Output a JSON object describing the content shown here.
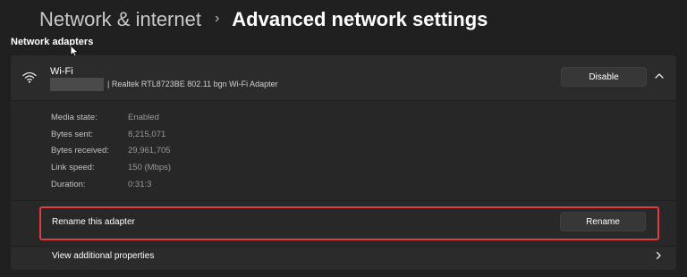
{
  "breadcrumb": {
    "parent": "Network & internet",
    "separator": "›",
    "current": "Advanced network settings"
  },
  "section_title": "Network adapters",
  "adapter": {
    "name": "Wi-Fi",
    "description": "| Realtek RTL8723BE 802.11 bgn Wi-Fi Adapter",
    "disable_label": "Disable",
    "icon": "wifi-icon",
    "expand_icon": "chevron-up-icon"
  },
  "stats": {
    "media_state_label": "Media state:",
    "media_state_value": "Enabled",
    "bytes_sent_label": "Bytes sent:",
    "bytes_sent_value": "8,215,071",
    "bytes_received_label": "Bytes received:",
    "bytes_received_value": "29,961,705",
    "link_speed_label": "Link speed:",
    "link_speed_value": "150 (Mbps)",
    "duration_label": "Duration:",
    "duration_value": "0:31:3"
  },
  "rename": {
    "label": "Rename this adapter",
    "button": "Rename"
  },
  "properties": {
    "label": "View additional properties",
    "icon": "chevron-right-icon"
  },
  "colors": {
    "background": "#202020",
    "card": "#2b2b2b",
    "highlight": "#e03c3c"
  }
}
